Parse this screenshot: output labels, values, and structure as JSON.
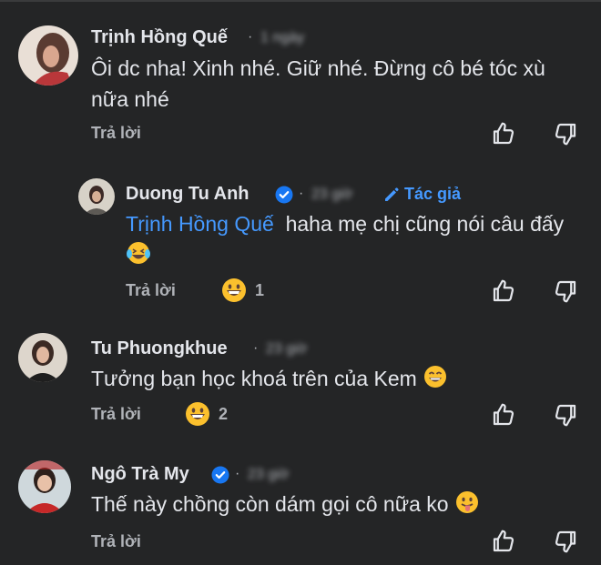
{
  "colors": {
    "background": "#242526",
    "text": "#e4e6eb",
    "muted": "#b0b3b8",
    "accent": "#4599ff",
    "verified": "#1877f2"
  },
  "comments": [
    {
      "name": "Trịnh Hồng Quế",
      "time": "1 ngày",
      "text": "Ôi dc nha! Xinh nhé. Giữ nhé. Đừng cô bé tóc xù nữa nhé",
      "reply_label": "Trả lời"
    },
    {
      "name": "Duong Tu Anh",
      "time": "23 giờ",
      "author_label": "Tác giả",
      "mention": "Trịnh Hồng Quế",
      "text": "haha mẹ chị cũng nói câu đấy",
      "reaction_count": "1",
      "reply_label": "Trả lời"
    },
    {
      "name": "Tu Phuongkhue",
      "time": "23 giờ",
      "text": "Tưởng bạn học khoá trên của Kem",
      "reaction_count": "2",
      "reply_label": "Trả lời"
    },
    {
      "name": "Ngô Trà My",
      "time": "23 giờ",
      "text": "Thế này chồng còn dám gọi cô nữa ko",
      "reply_label": "Trả lời"
    }
  ],
  "icons": [
    "thumbs-up-icon",
    "thumbs-down-icon",
    "verified-badge-icon",
    "pencil-icon",
    "emoji-icon"
  ]
}
